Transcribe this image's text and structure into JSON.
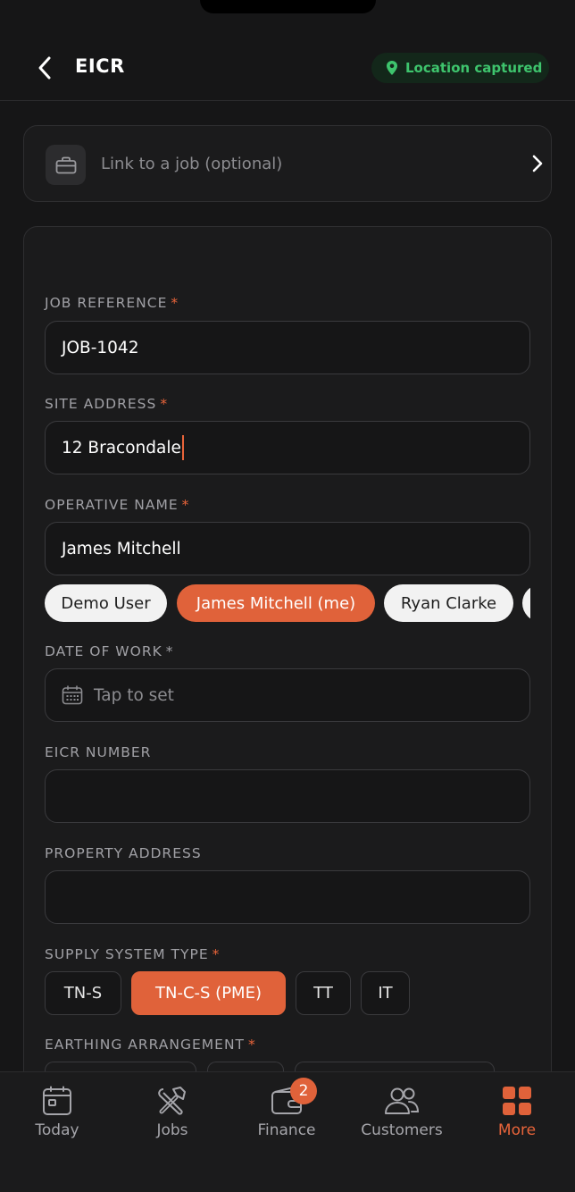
{
  "header": {
    "title": "EICR",
    "location_badge": "Location captured"
  },
  "link_job": {
    "label": "Link to a job (optional)"
  },
  "form": {
    "job_reference": {
      "label": "JOB REFERENCE",
      "required_mark": "*",
      "value": "JOB-1042"
    },
    "site_address": {
      "label": "SITE ADDRESS",
      "required_mark": "*",
      "value": "12 Bracondale"
    },
    "operative_name": {
      "label": "OPERATIVE NAME",
      "required_mark": "*",
      "value": "James Mitchell",
      "suggestions": [
        "Demo User",
        "James Mitchell (me)",
        "Ryan Clarke"
      ],
      "selected_suggestion": "James Mitchell (me)"
    },
    "date_of_work": {
      "label": "DATE OF WORK",
      "required_mark": "*",
      "placeholder": "Tap to set"
    },
    "eicr_number": {
      "label": "EICR NUMBER",
      "value": ""
    },
    "property_address": {
      "label": "PROPERTY ADDRESS",
      "value": ""
    },
    "supply_system_type": {
      "label": "SUPPLY SYSTEM TYPE",
      "required_mark": "*",
      "options": [
        "TN-S",
        "TN-C-S (PME)",
        "TT",
        "IT"
      ],
      "selected": "TN-C-S (PME)"
    },
    "earthing_arrangement": {
      "label": "EARTHING ARRANGEMENT",
      "required_mark": "*"
    }
  },
  "tabbar": {
    "items": [
      {
        "label": "Today",
        "icon": "calendar-icon"
      },
      {
        "label": "Jobs",
        "icon": "tools-icon"
      },
      {
        "label": "Finance",
        "icon": "wallet-icon",
        "badge": "2"
      },
      {
        "label": "Customers",
        "icon": "people-icon"
      },
      {
        "label": "More",
        "icon": "grid-icon",
        "active": true
      }
    ]
  },
  "colors": {
    "accent": "#e0623a",
    "success": "#3ec46d",
    "background": "#161617"
  }
}
